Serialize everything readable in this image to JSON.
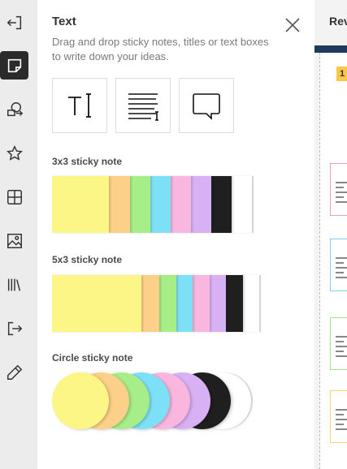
{
  "sidebar": {
    "items": [
      {
        "name": "exit-icon",
        "active": false
      },
      {
        "name": "sticky-note-icon",
        "active": true
      },
      {
        "name": "shapes-icon",
        "active": false
      },
      {
        "name": "star-icon",
        "active": false
      },
      {
        "name": "grid-icon",
        "active": false
      },
      {
        "name": "image-icon",
        "active": false
      },
      {
        "name": "library-icon",
        "active": false
      },
      {
        "name": "import-icon",
        "active": false
      },
      {
        "name": "pencil-icon",
        "active": false
      }
    ]
  },
  "panel": {
    "title": "Text",
    "description": "Drag and drop sticky notes, titles or text boxes to write down your ideas.",
    "tools": [
      {
        "name": "text-tool-icon"
      },
      {
        "name": "text-block-tool-icon"
      },
      {
        "name": "speech-bubble-tool-icon"
      }
    ],
    "sections": {
      "sticky3": {
        "label": "3x3 sticky note"
      },
      "sticky5": {
        "label": "5x3 sticky note"
      },
      "circle": {
        "label": "Circle sticky note"
      }
    },
    "colors": [
      "#fbf685",
      "#fdd08a",
      "#a8ee88",
      "#7ee0f6",
      "#f9b6de",
      "#d8b1f4",
      "#1f1f1f",
      "#ffffff"
    ]
  },
  "canvas": {
    "tab_label": "Rev",
    "badge": "1"
  }
}
